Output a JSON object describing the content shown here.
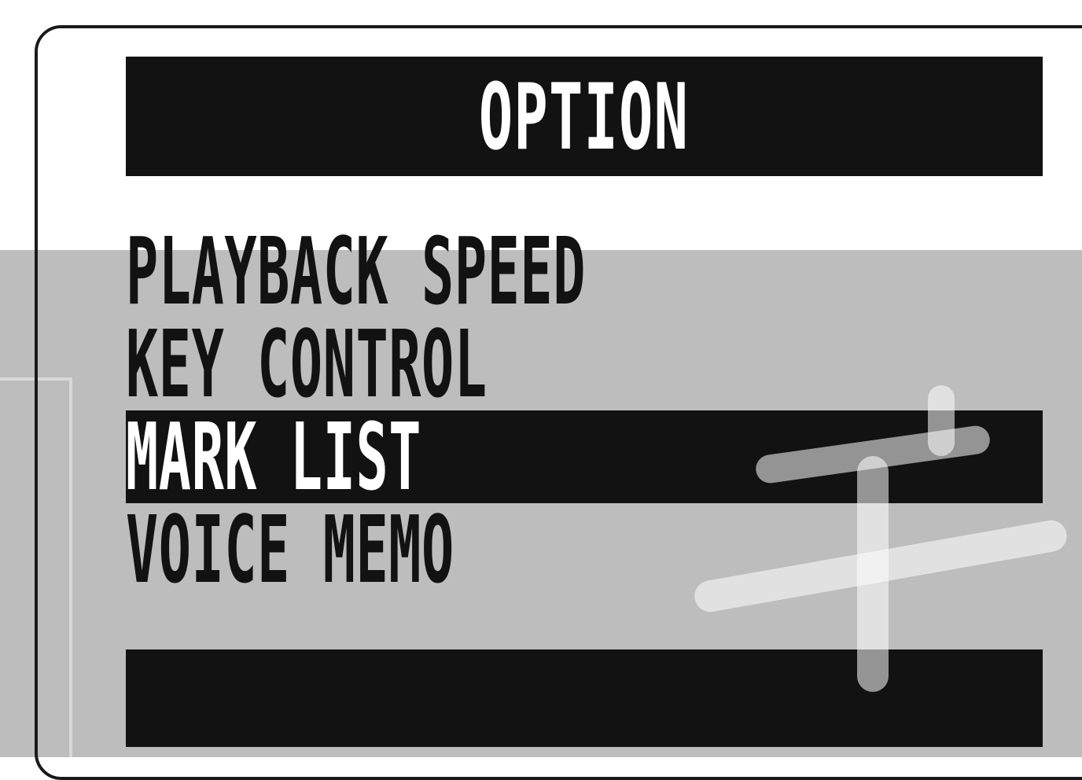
{
  "screen": {
    "title": "OPTION",
    "menu_items": [
      {
        "label": "PLAYBACK SPEED",
        "selected": false
      },
      {
        "label": "KEY CONTROL",
        "selected": false
      },
      {
        "label": "MARK LIST",
        "selected": true
      },
      {
        "label": "VOICE MEMO",
        "selected": false
      }
    ],
    "colors": {
      "lcd_black": "#121212",
      "lcd_white": "#ffffff",
      "background_grey": "#bdbdbd"
    }
  }
}
